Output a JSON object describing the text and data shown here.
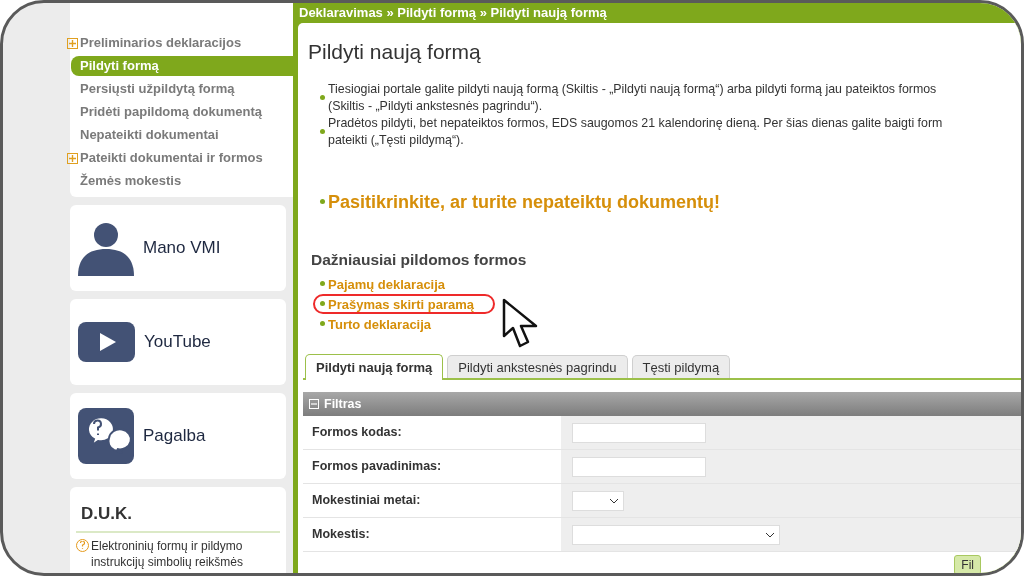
{
  "sidebar": {
    "menu": [
      {
        "label": "Preliminarios deklaracijos",
        "expandable": true,
        "selected": false
      },
      {
        "label": "Pildyti formą",
        "expandable": false,
        "selected": true
      },
      {
        "label": "Persiųsti užpildytą formą",
        "expandable": false,
        "selected": false
      },
      {
        "label": "Pridėti papildomą dokumentą",
        "expandable": false,
        "selected": false
      },
      {
        "label": "Nepateikti dokumentai",
        "expandable": false,
        "selected": false
      },
      {
        "label": "Pateikti dokumentai ir formos",
        "expandable": true,
        "selected": false
      },
      {
        "label": "Žemės mokestis",
        "expandable": false,
        "selected": false
      }
    ],
    "cards": [
      {
        "label": "Mano VMI",
        "kind": "person"
      },
      {
        "label": "YouTube",
        "kind": "video"
      },
      {
        "label": "Pagalba",
        "kind": "help"
      }
    ],
    "faq": {
      "title": "D.U.K.",
      "items": [
        "Elektroninių formų ir pildymo instrukcijų simbolių reikšmės"
      ]
    }
  },
  "breadcrumb": "Deklaravimas » Pildyti formą » Pildyti naują formą",
  "page_title": "Pildyti naują formą",
  "info": [
    {
      "lines": [
        "Tiesiogiai portale galite pildyti naują formą (Skiltis - „Pildyti naują formą“) arba pildyti formą jau pateiktos formos",
        "(Skiltis - „Pildyti ankstesnės pagrindu“)."
      ]
    },
    {
      "lines": [
        "Pradėtos pildyti, bet nepateiktos formos, EDS saugomos 21 kalendorinę dieną. Per šias dienas galite baigti form",
        "pateikti („Tęsti pildymą“)."
      ]
    }
  ],
  "alert": "Pasitikrinkite, ar turite nepateiktų dokumentų!",
  "frequent": {
    "title": "Dažniausiai pildomos formos",
    "links": [
      {
        "label": "Pajamų deklaracija",
        "highlighted": false
      },
      {
        "label": "Prašymas skirti paramą",
        "highlighted": true
      },
      {
        "label": "Turto deklaracija",
        "highlighted": false
      }
    ]
  },
  "tabs": [
    {
      "label": "Pildyti naują formą",
      "selected": true
    },
    {
      "label": "Pildyti ankstesnės pagrindu",
      "selected": false
    },
    {
      "label": "Tęsti pildymą",
      "selected": false
    }
  ],
  "filter": {
    "title": "Filtras",
    "expanded": true,
    "fields": [
      {
        "label": "Formos kodas:",
        "kind": "text"
      },
      {
        "label": "Formos pavadinimas:",
        "kind": "text"
      },
      {
        "label": "Mokestiniai metai:",
        "kind": "short-select"
      },
      {
        "label": "Mokestis:",
        "kind": "select"
      }
    ],
    "button": "Fil"
  }
}
